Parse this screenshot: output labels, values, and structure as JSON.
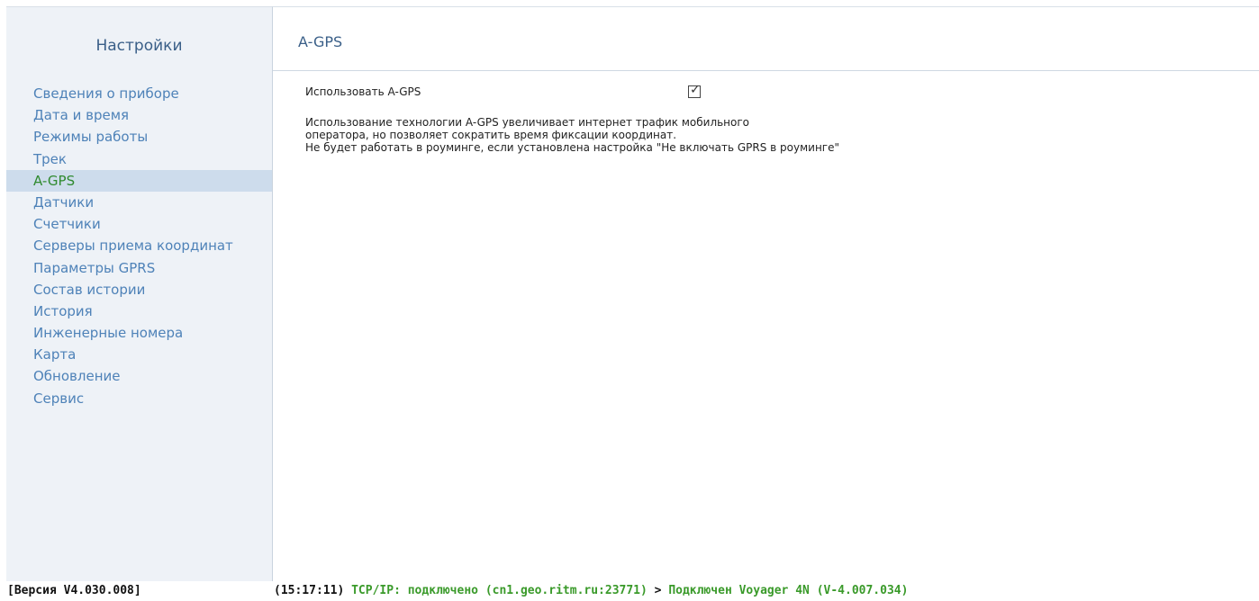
{
  "sidebar": {
    "title": "Настройки",
    "items": [
      {
        "label": "Сведения о приборе"
      },
      {
        "label": "Дата и время"
      },
      {
        "label": "Режимы работы"
      },
      {
        "label": "Трек"
      },
      {
        "label": "A-GPS",
        "active": true
      },
      {
        "label": "Датчики"
      },
      {
        "label": "Счетчики"
      },
      {
        "label": "Серверы приема координат"
      },
      {
        "label": "Параметры GPRS"
      },
      {
        "label": "Состав истории"
      },
      {
        "label": "История"
      },
      {
        "label": "Инженерные номера"
      },
      {
        "label": "Карта"
      },
      {
        "label": "Обновление"
      },
      {
        "label": "Сервис"
      }
    ]
  },
  "main": {
    "title": "A-GPS",
    "option": {
      "label": "Использовать A-GPS",
      "checked": true
    },
    "description": [
      "Использование технологии A-GPS увеличивает интернет трафик мобильного",
      "оператора, но позволяет сократить время фиксации координат.",
      "Не будет работать в роуминге, если установлена настройка \"Не включать GPRS в роуминге\""
    ]
  },
  "status_bar": {
    "version": "[Версия V4.030.008]",
    "time": "(15:17:11)",
    "tcp": "TCP/IP: подключено (cn1.geo.ritm.ru:23771)",
    "arrow": ">",
    "device": "Подключен Voyager 4N (V-4.007.034)"
  },
  "colors": {
    "accent": "#3a5f88",
    "link": "#4e82b8",
    "active_text": "#2f8a2f",
    "status_ok": "#3a9a2a"
  }
}
